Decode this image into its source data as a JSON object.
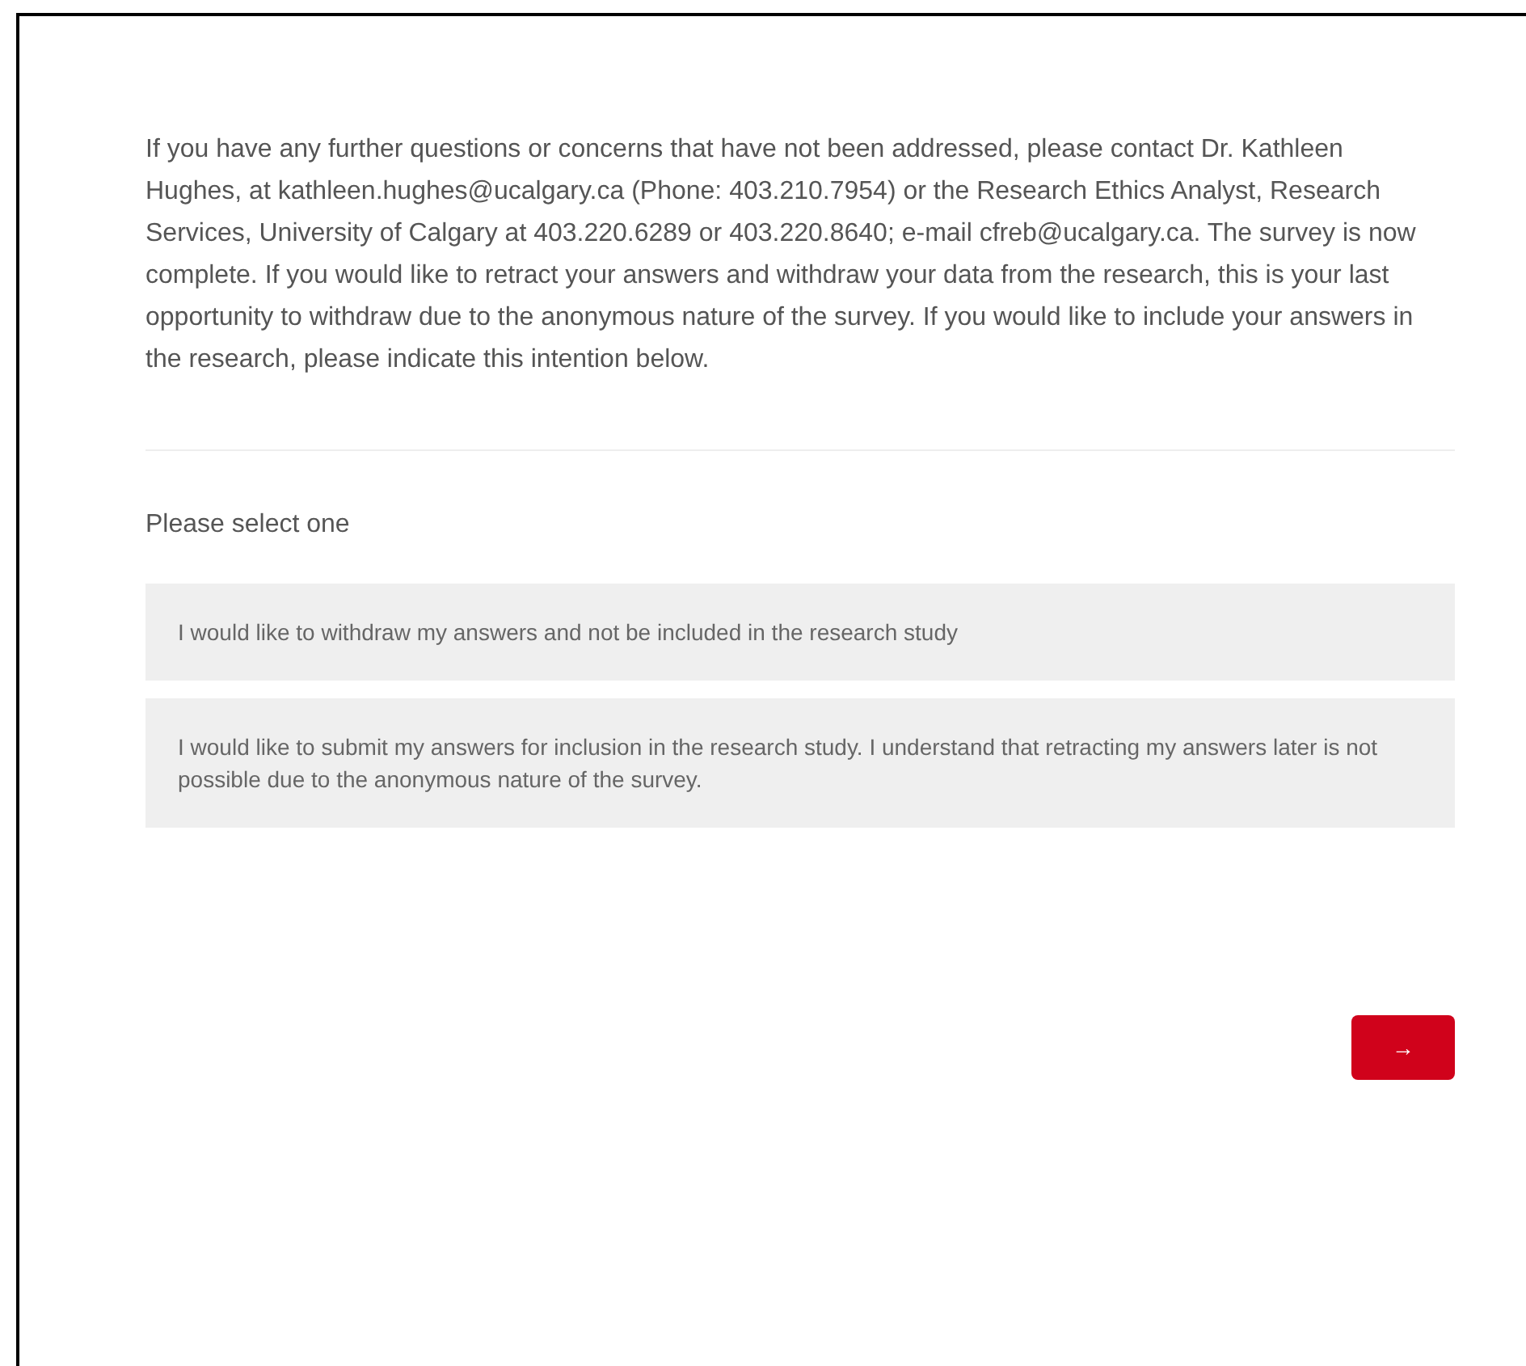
{
  "intro": "If you have any further questions or concerns that have not been addressed, please contact Dr. Kathleen Hughes, at kathleen.hughes@ucalgary.ca (Phone: 403.210.7954) or the Research Ethics Analyst, Research Services, University of Calgary at 403.220.6289 or 403.220.8640; e-mail cfreb@ucalgary.ca. The survey is now complete. If you would like to retract your answers and withdraw your data from the research, this is your last opportunity to withdraw due to the anonymous nature of the survey. If you would like to include your answers in the research, please indicate this intention below.",
  "question": "Please select one",
  "choices": [
    {
      "label": "I would like to withdraw my answers and not be included in the research study",
      "selected": false
    },
    {
      "label": "I would like to submit my answers for inclusion in the research study. I understand that retracting my answers later is not possible due to the anonymous nature of the survey.",
      "selected": false
    }
  ],
  "next_button": "→"
}
